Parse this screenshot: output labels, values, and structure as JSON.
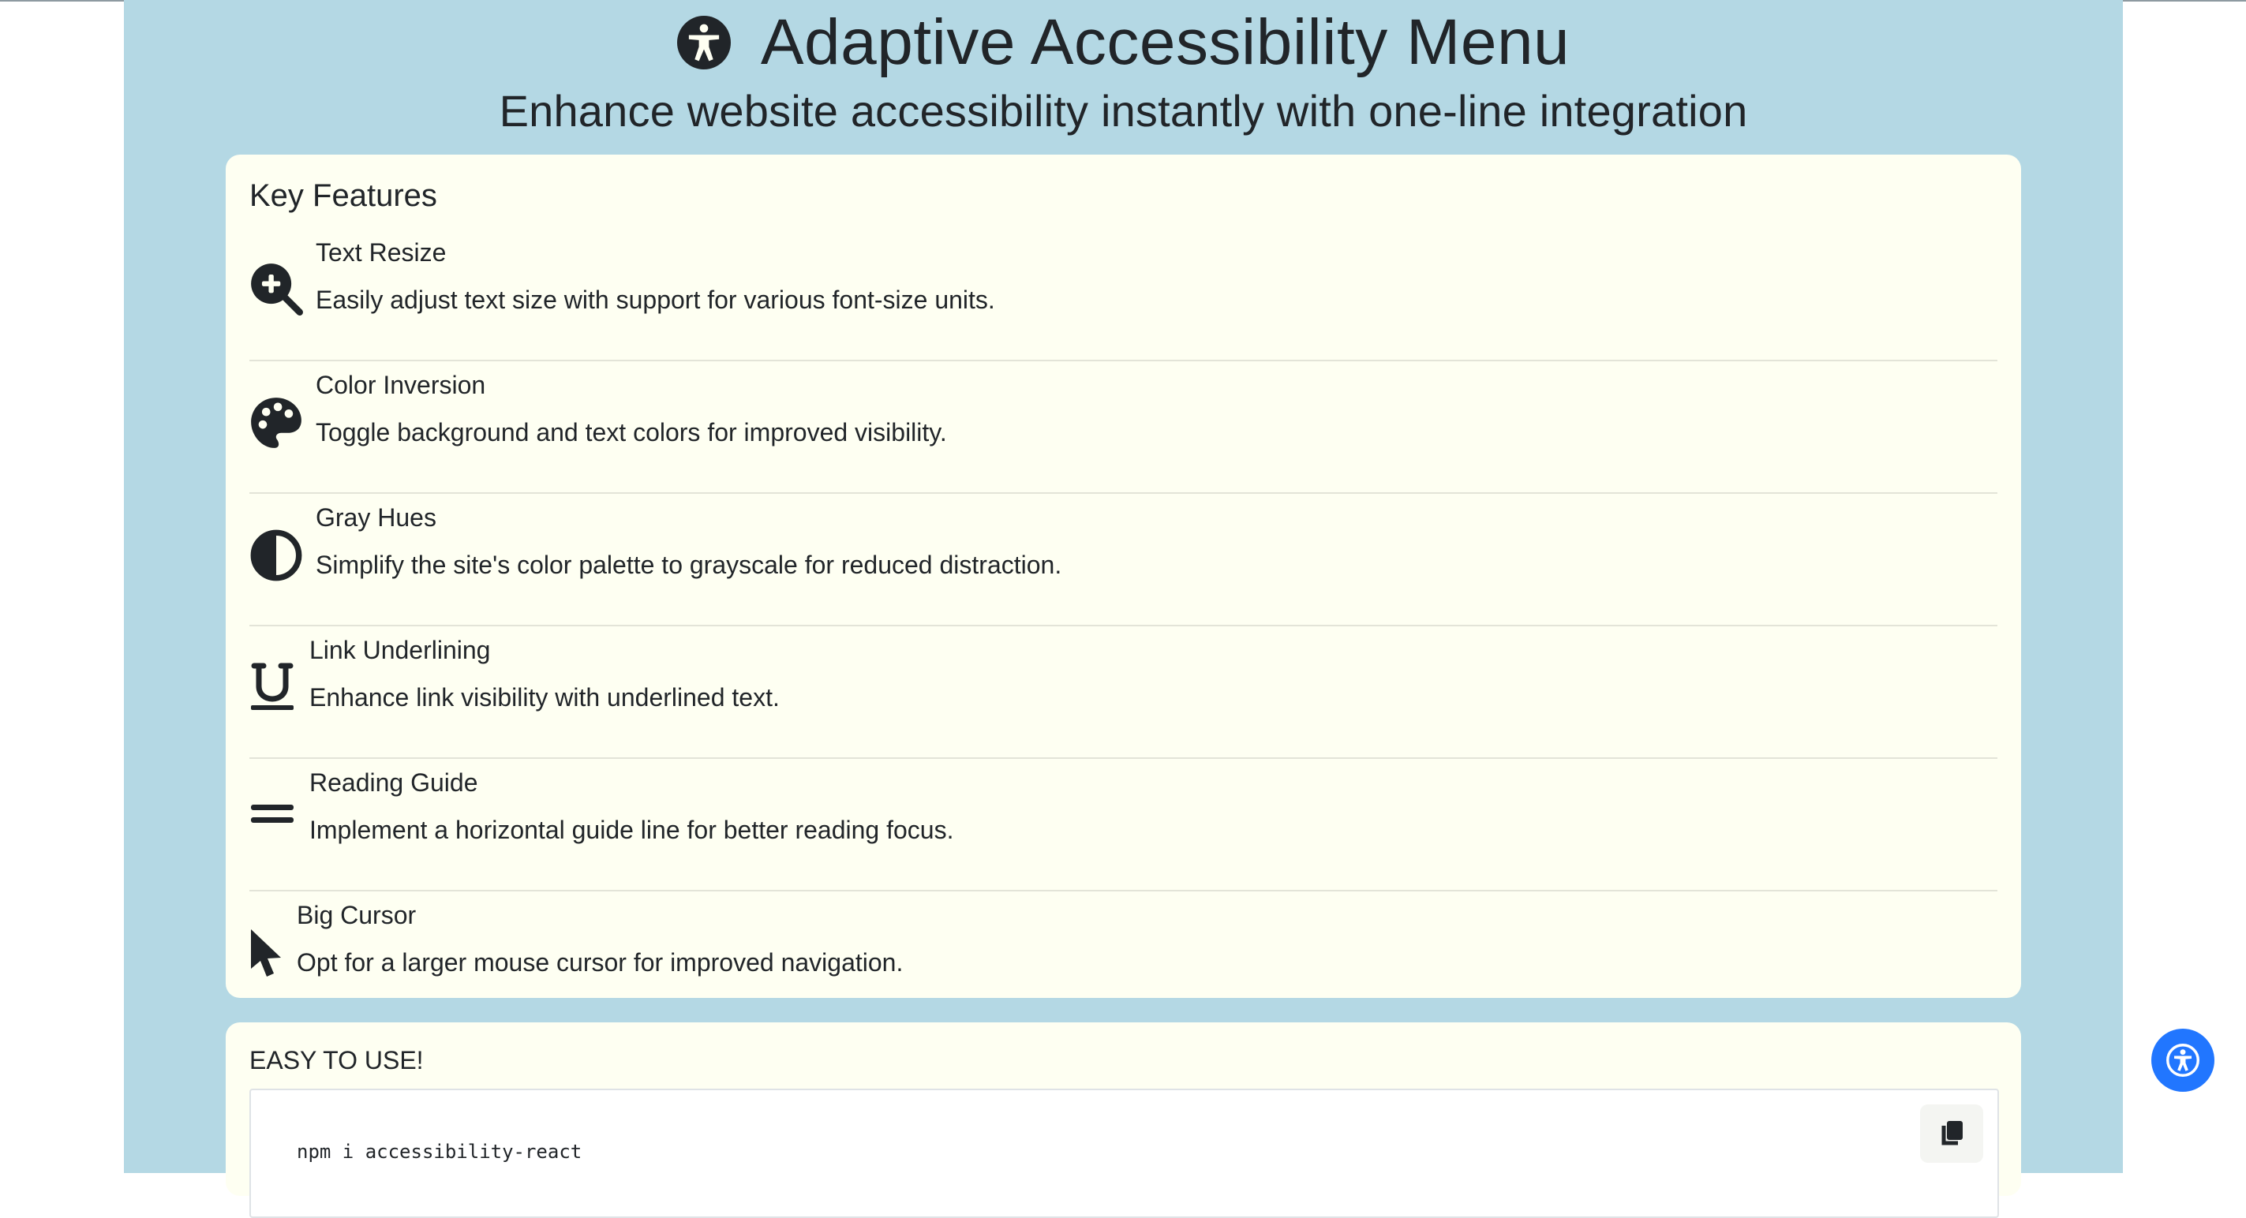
{
  "header": {
    "icon": "universal-access-icon",
    "title": "Adaptive Accessibility Menu",
    "subtitle": "Enhance website accessibility instantly with one-line integration"
  },
  "features": {
    "heading": "Key Features",
    "items": [
      {
        "icon": "magnifier-plus-icon",
        "name": "Text Resize",
        "description": "Easily adjust text size with support for various font-size units."
      },
      {
        "icon": "palette-icon",
        "name": "Color Inversion",
        "description": "Toggle background and text colors for improved visibility."
      },
      {
        "icon": "half-circle-contrast-icon",
        "name": "Gray Hues",
        "description": "Simplify the site's color palette to grayscale for reduced distraction."
      },
      {
        "icon": "underline-icon",
        "name": "Link Underlining",
        "description": "Enhance link visibility with underlined text."
      },
      {
        "icon": "equals-lines-icon",
        "name": "Reading Guide",
        "description": "Implement a horizontal guide line for better reading focus."
      },
      {
        "icon": "arrow-cursor-icon",
        "name": "Big Cursor",
        "description": "Opt for a larger mouse cursor for improved navigation."
      }
    ]
  },
  "usage": {
    "heading": "EASY TO USE!",
    "code": "npm i accessibility-react",
    "copy_icon": "copy-icon"
  },
  "floating_button": {
    "icon": "universal-access-icon"
  },
  "colors": {
    "page_background": "#b4d8e4",
    "card_background": "#fefff2",
    "accent": "#2176ff",
    "text": "#212529"
  }
}
